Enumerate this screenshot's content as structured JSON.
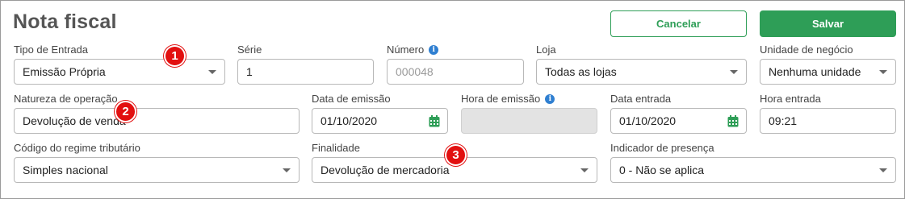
{
  "header": {
    "title": "Nota fiscal",
    "cancel_label": "Cancelar",
    "save_label": "Salvar"
  },
  "fields": {
    "tipo_entrada": {
      "label": "Tipo de Entrada",
      "value": "Emissão Própria"
    },
    "serie": {
      "label": "Série",
      "value": "1"
    },
    "numero": {
      "label": "Número",
      "placeholder": "000048"
    },
    "loja": {
      "label": "Loja",
      "value": "Todas as lojas"
    },
    "unidade_negocio": {
      "label": "Unidade de negócio",
      "value": "Nenhuma unidade"
    },
    "natureza_operacao": {
      "label": "Natureza de operação",
      "value": "Devolução de venda"
    },
    "data_emissao": {
      "label": "Data de emissão",
      "value": "01/10/2020"
    },
    "hora_emissao": {
      "label": "Hora de emissão",
      "value": ""
    },
    "data_entrada": {
      "label": "Data entrada",
      "value": "01/10/2020"
    },
    "hora_entrada": {
      "label": "Hora entrada",
      "value": "09:21"
    },
    "regime_tributario": {
      "label": "Código do regime tributário",
      "value": "Simples nacional"
    },
    "finalidade": {
      "label": "Finalidade",
      "value": "Devolução de mercadoria"
    },
    "indicador_presenca": {
      "label": "Indicador de presença",
      "value": "0 - Não se aplica"
    }
  },
  "info_icon_glyph": "i",
  "callouts": [
    "1",
    "2",
    "3"
  ],
  "colors": {
    "primary_green": "#2e9e57",
    "callout_red": "#e20f0f",
    "info_blue": "#2f7fd1",
    "calendar_green": "#2e9e57"
  },
  "icons": {
    "select": "chevron-down-icon",
    "date": "calendar-icon",
    "info": "info-icon"
  }
}
